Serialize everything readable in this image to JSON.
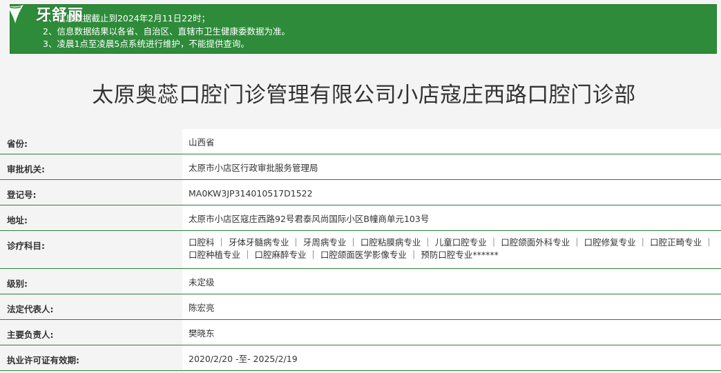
{
  "logo": {
    "text": "牙舒丽"
  },
  "notice": {
    "line1": "1、信息数据截止到2024年2月11日22时；",
    "line2": "2、信息数据结果以各省、自治区、直辖市卫生健康委数据为准。",
    "line3": "3、凌晨1点至凌晨5点系统进行维护，不能提供查询。"
  },
  "title": "太原奥蕊口腔门诊管理有限公司小店寇庄西路口腔门诊部",
  "details": [
    {
      "label": "省份:",
      "value": "山西省"
    },
    {
      "label": "审批机关:",
      "value": "太原市小店区行政审批服务管理局"
    },
    {
      "label": "登记号:",
      "value": "MA0KW3JP314010517D1522"
    },
    {
      "label": "地址:",
      "value": "太原市小店区寇庄西路92号君泰风尚国际小区B幢商单元103号"
    },
    {
      "label": "诊疗科目:",
      "value": "口腔科 ｜ 牙体牙髓病专业 ｜ 牙周病专业 ｜ 口腔粘膜病专业 ｜ 儿童口腔专业 ｜ 口腔颌面外科专业 ｜ 口腔修复专业 ｜ 口腔正畸专业 ｜ 口腔种植专业 ｜ 口腔麻醉专业 ｜ 口腔颌面医学影像专业 ｜ 预防口腔专业******"
    },
    {
      "label": "级别:",
      "value": "未定级"
    },
    {
      "label": "法定代表人:",
      "value": "陈宏亮"
    },
    {
      "label": "主要负责人:",
      "value": "樊晓东"
    },
    {
      "label": "执业许可证有效期:",
      "value": "2020/2/20 -至- 2025/2/19"
    }
  ],
  "colors": {
    "notice_bg": "#2e8b3a",
    "row_border": "#2e7d3a",
    "label_bg": "#f4f4f4",
    "value_bg": "#ffffff"
  }
}
